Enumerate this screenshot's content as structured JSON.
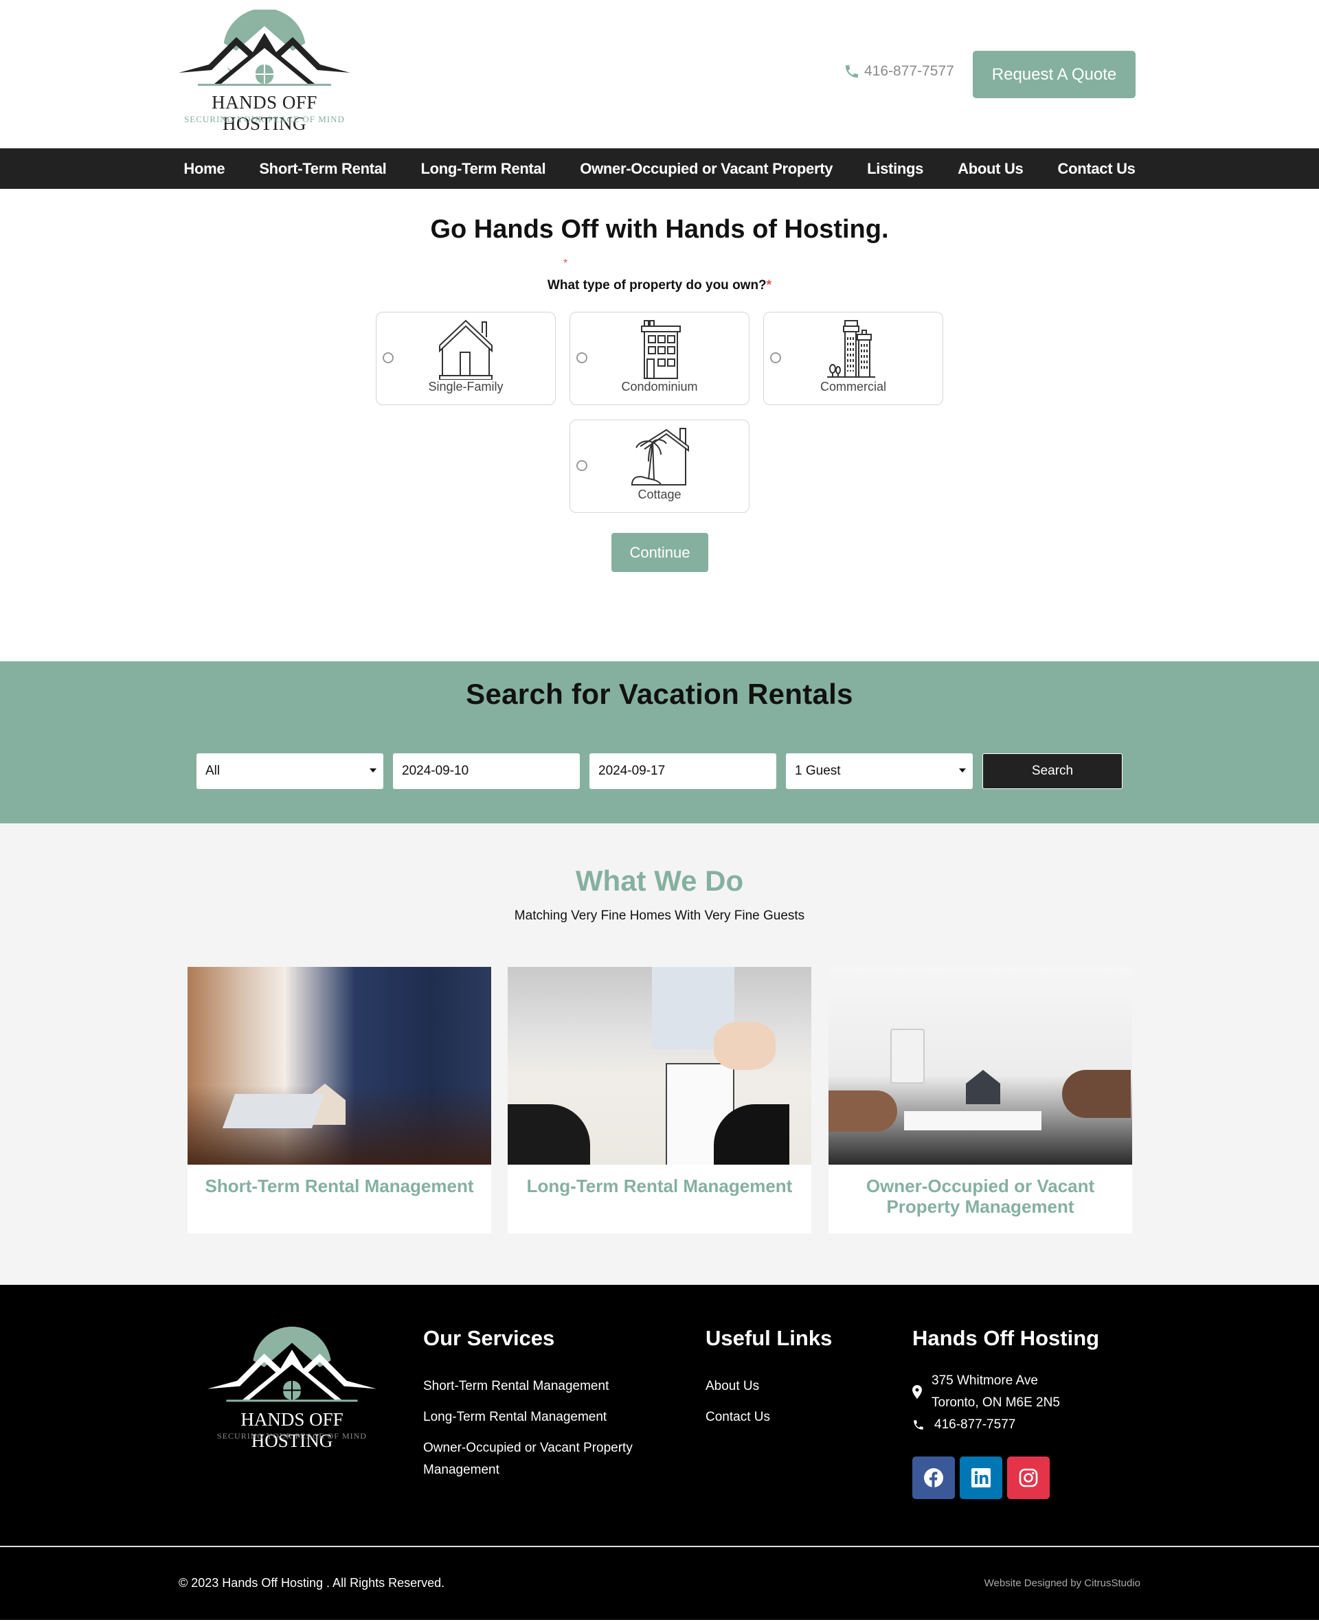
{
  "header": {
    "logo_title": "HANDS OFF HOSTING",
    "logo_tagline": "SECURING YOUR PEACE OF MIND",
    "phone": "416-877-7577",
    "quote_button": "Request A Quote"
  },
  "nav": {
    "items": [
      {
        "label": "Home"
      },
      {
        "label": "Short-Term Rental"
      },
      {
        "label": "Long-Term Rental"
      },
      {
        "label": "Owner-Occupied or Vacant Property"
      },
      {
        "label": "Listings"
      },
      {
        "label": "About Us"
      },
      {
        "label": "Contact Us"
      }
    ]
  },
  "form": {
    "title": "Go Hands Off with Hands of Hosting.",
    "required_marker": "*",
    "question": "What type of property do you own?",
    "options": [
      {
        "label": "Single-Family",
        "icon": "house-icon",
        "selected": false
      },
      {
        "label": "Condominium",
        "icon": "apartment-building-icon",
        "selected": false
      },
      {
        "label": "Commercial",
        "icon": "office-buildings-icon",
        "selected": false
      },
      {
        "label": "Cottage",
        "icon": "cottage-palm-icon",
        "selected": false
      }
    ],
    "continue_button": "Continue"
  },
  "search": {
    "title": "Search for Vacation Rentals",
    "type_select": "All",
    "checkin": "2024-09-10",
    "checkout": "2024-09-17",
    "guests_select": "1 Guest",
    "search_button": "Search"
  },
  "what_we_do": {
    "title": "What We Do",
    "subtitle": "Matching Very Fine Homes With Very Fine Guests",
    "cards": [
      {
        "title": "Short-Term Rental Management",
        "image": "agent-handing-keys-with-house-model-photo"
      },
      {
        "title": "Long-Term Rental Management",
        "image": "signing-contract-receiving-keys-photo"
      },
      {
        "title": "Owner-Occupied or Vacant Property Management",
        "image": "calculator-and-house-model-photo"
      }
    ]
  },
  "footer": {
    "logo_title": "HANDS OFF HOSTING",
    "logo_tagline": "SECURING YOUR PEACE OF MIND",
    "services_heading": "Our Services",
    "services": [
      "Short-Term Rental Management",
      "Long-Term Rental Management",
      "Owner-Occupied or Vacant Property Management"
    ],
    "links_heading": "Useful Links",
    "links": [
      "About Us",
      "Contact Us"
    ],
    "company_heading": "Hands Off Hosting",
    "address_line1": "375 Whitmore Ave",
    "address_line2": "Toronto, ON M6E 2N5",
    "phone": "416-877-7577",
    "socials": [
      {
        "name": "facebook",
        "color": "#3b5998"
      },
      {
        "name": "linkedin",
        "color": "#0077b5"
      },
      {
        "name": "instagram",
        "color": "#e4344a"
      }
    ],
    "copyright": "© 2023 Hands Off Hosting . All Rights Reserved.",
    "credit": "Website Designed by CitrusStudio"
  },
  "colors": {
    "accent": "#85b0a0",
    "nav_bg": "#222222",
    "footer_bg": "#000000",
    "section_bg": "#f4f4f4",
    "required": "#d9534f"
  }
}
